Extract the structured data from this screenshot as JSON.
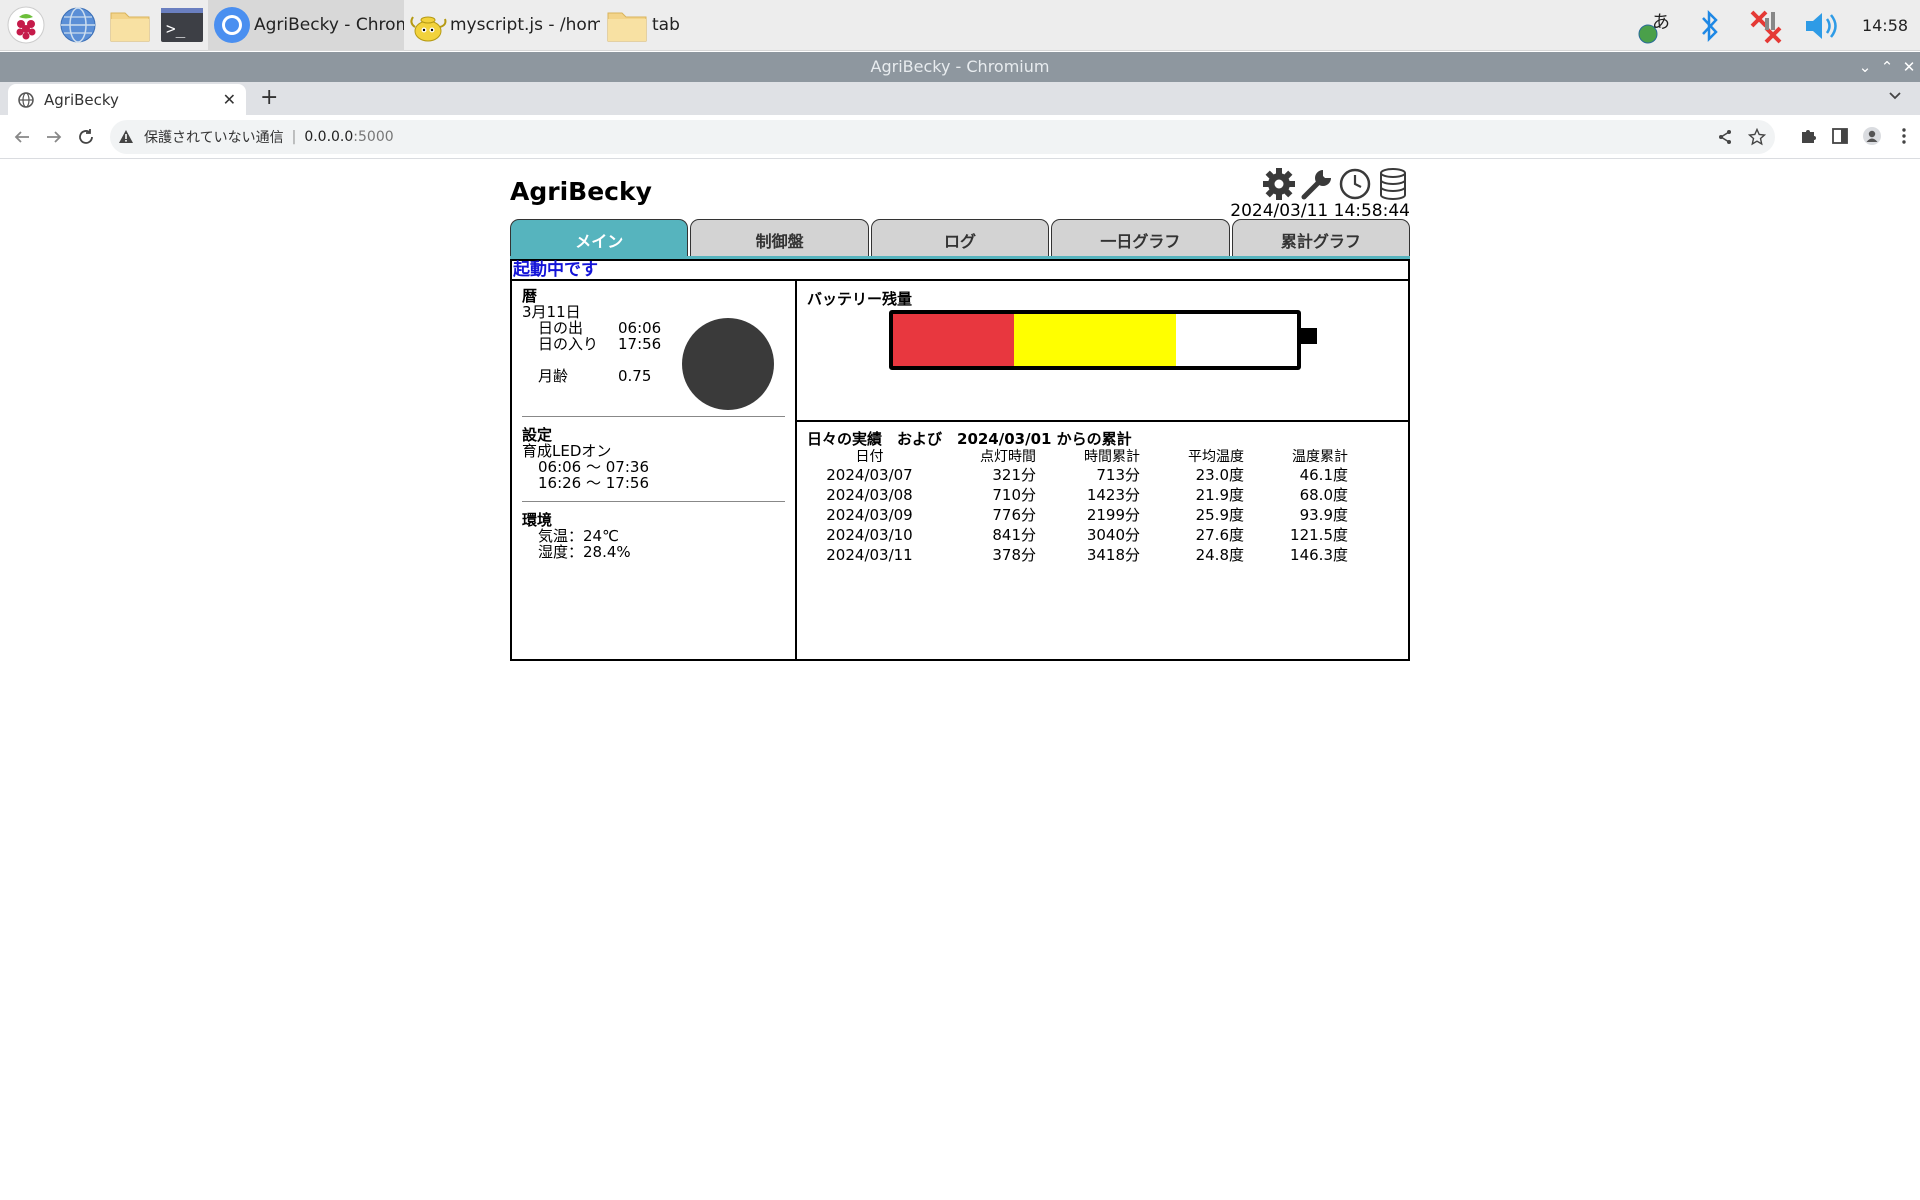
{
  "taskbar": {
    "apps": [
      {
        "label": "AgriBecky - Chromi...",
        "icon": "chromium-icon",
        "active": true
      },
      {
        "label": "myscript.js - /hom...",
        "icon": "geany-teapot-icon",
        "active": false
      },
      {
        "label": "tab",
        "icon": "folder-icon",
        "active": false
      }
    ],
    "clock": "14:58"
  },
  "window": {
    "title": "AgriBecky - Chromium"
  },
  "browser": {
    "tab_title": "AgriBecky",
    "insecure_label": "保護されていない通信",
    "host": "0.0.0.0",
    "port": ":5000"
  },
  "app": {
    "title": "AgriBecky",
    "datetime": "2024/03/11 14:58:44",
    "tabs": [
      "メイン",
      "制御盤",
      "ログ",
      "一日グラフ",
      "累計グラフ"
    ],
    "active_tab": 0,
    "status": "起動中です"
  },
  "calendar": {
    "heading": "暦",
    "date": "3月11日",
    "sunrise_label": "日の出",
    "sunrise": "06:06",
    "sunset_label": "日の入り",
    "sunset": "17:56",
    "moon_age_label": "月齢",
    "moon_age": "0.75"
  },
  "settings": {
    "heading": "設定",
    "led_label": "育成LEDオン",
    "ranges": [
      "06:06 〜 07:36",
      "16:26 〜 17:56"
    ]
  },
  "environment": {
    "heading": "環境",
    "temperature": "気温：24℃",
    "humidity": "湿度：28.4%"
  },
  "battery": {
    "label": "バッテリー残量",
    "colors": {
      "red": "#e8373f",
      "yellow": "#ffff00"
    },
    "red_fraction": 0.3,
    "yellow_fraction": 0.4
  },
  "daily": {
    "title": "日々の実績　および　2024/03/01 からの累計",
    "headers": [
      "日付",
      "点灯時間",
      "時間累計",
      "平均温度",
      "温度累計"
    ],
    "rows": [
      [
        "2024/03/07",
        "321分",
        "713分",
        "23.0度",
        "46.1度"
      ],
      [
        "2024/03/08",
        "710分",
        "1423分",
        "21.9度",
        "68.0度"
      ],
      [
        "2024/03/09",
        "776分",
        "2199分",
        "25.9度",
        "93.9度"
      ],
      [
        "2024/03/10",
        "841分",
        "3040分",
        "27.6度",
        "121.5度"
      ],
      [
        "2024/03/11",
        "378分",
        "3418分",
        "24.8度",
        "146.3度"
      ]
    ]
  },
  "accent_color": "#56b4be"
}
